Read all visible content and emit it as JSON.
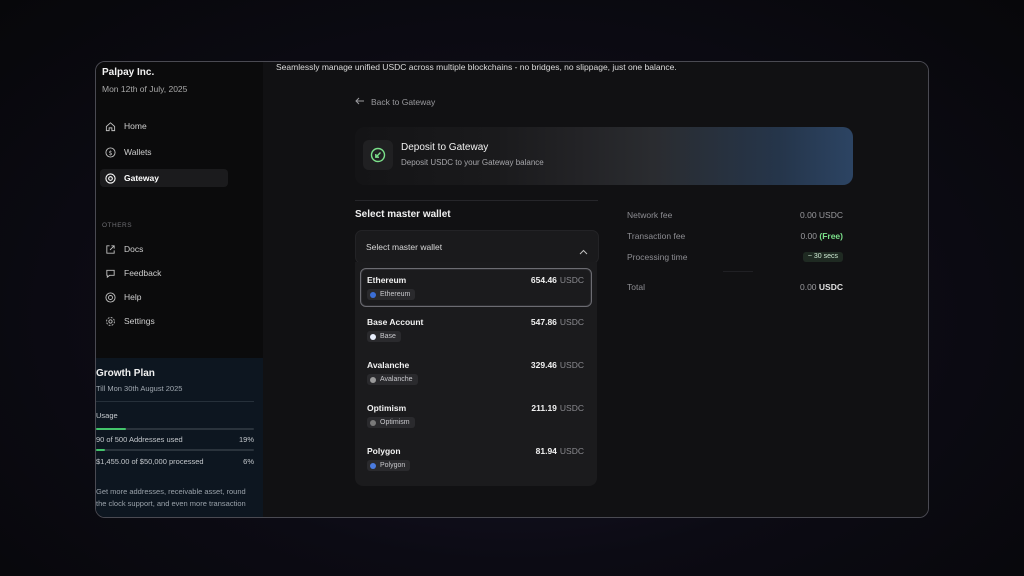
{
  "sidebar": {
    "org_name": "Palpay Inc.",
    "date": "Mon 12th of July, 2025",
    "nav": [
      {
        "label": "Home",
        "icon": "home-icon"
      },
      {
        "label": "Wallets",
        "icon": "dollar-icon"
      },
      {
        "label": "Gateway",
        "icon": "gateway-icon",
        "active": true
      }
    ],
    "others_label": "OTHERS",
    "others": [
      {
        "label": "Docs",
        "icon": "external-link-icon"
      },
      {
        "label": "Feedback",
        "icon": "chat-icon"
      },
      {
        "label": "Help",
        "icon": "lifebuoy-icon"
      },
      {
        "label": "Settings",
        "icon": "gear-icon"
      }
    ],
    "plan": {
      "title": "Growth Plan",
      "subtitle": "Till Mon 30th August 2025",
      "usage_label": "Usage",
      "addresses_text": "90 of 500 Addresses used",
      "addresses_pct": "19%",
      "addresses_fraction": 0.19,
      "processed_text": "$1,455.00 of $50,000 processed",
      "processed_pct": "6%",
      "processed_fraction": 0.06,
      "note": "Get more addresses, receivable asset, round the clock support, and even more transaction"
    }
  },
  "main": {
    "subtitle": "Seamlessly manage unified USDC across multiple blockchains - no bridges, no slippage, just one balance.",
    "back_label": "Back to Gateway",
    "banner": {
      "title": "Deposit to Gateway",
      "subtitle": "Deposit USDC to your Gateway balance",
      "icon": "deposit-arrow-icon"
    },
    "select_title": "Select master wallet",
    "dropdown_label": "Select master wallet",
    "wallets": [
      {
        "name": "Ethereum",
        "amount": "654.46",
        "unit": "USDC",
        "chain": "Ethereum",
        "color": "#3b6fd8",
        "selected": true
      },
      {
        "name": "Base Account",
        "amount": "547.86",
        "unit": "USDC",
        "chain": "Base",
        "color": "#e8eefc"
      },
      {
        "name": "Avalanche",
        "amount": "329.46",
        "unit": "USDC",
        "chain": "Avalanche",
        "color": "#9a9a9a"
      },
      {
        "name": "Optimism",
        "amount": "211.19",
        "unit": "USDC",
        "chain": "Optimism",
        "color": "#7a7a7a"
      },
      {
        "name": "Polygon",
        "amount": "81.94",
        "unit": "USDC",
        "chain": "Polygon",
        "color": "#4a7be0"
      }
    ],
    "fees": {
      "network_fee_label": "Network fee",
      "network_fee_value": "0.00 USDC",
      "transaction_fee_label": "Transaction fee",
      "transaction_fee_value": "0.00",
      "transaction_fee_free": "(Free)",
      "processing_time_label": "Processing time",
      "processing_time_value": "~ 30 secs",
      "total_label": "Total",
      "total_value": "0.00",
      "total_unit": "USDC"
    }
  },
  "colors": {
    "accent_green": "#43c46b",
    "free_green": "#7be08a"
  }
}
